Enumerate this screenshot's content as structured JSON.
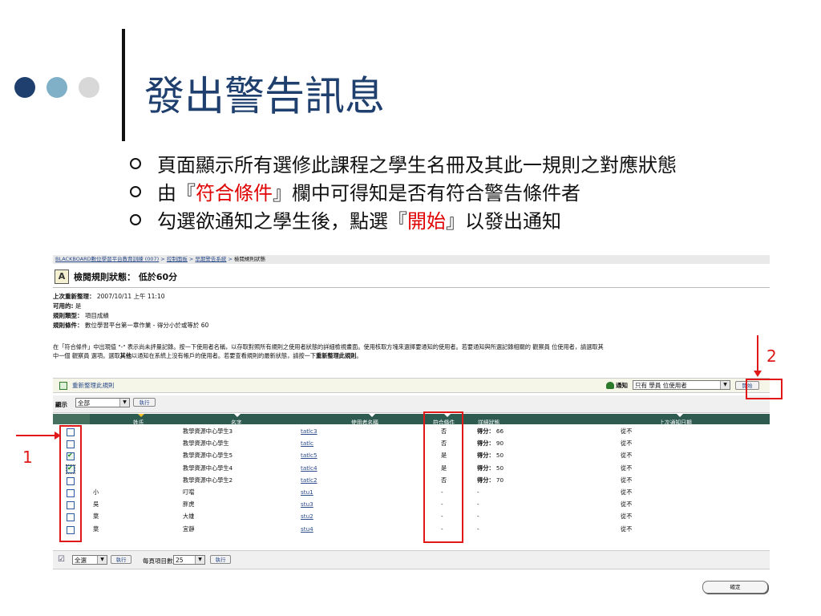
{
  "slide": {
    "title": "發出警告訊息",
    "bullets": [
      {
        "before": "頁面顯示所有選修此課程之學生名冊及其此一規則之對應狀態",
        "highlight": "",
        "after": ""
      },
      {
        "before": "由『",
        "highlight": "符合條件",
        "after": "』欄中可得知是否有符合警告條件者"
      },
      {
        "before": "勾選欲通知之學生後，點選『",
        "highlight": "開始",
        "after": "』以發出通知"
      }
    ],
    "colors": {
      "title": "#1f3f6e",
      "highlight": "#e00000",
      "annotation": "#e01818",
      "header": "#2e5b4f"
    }
  },
  "breadcrumb": {
    "items": [
      "BLACKBOARD數位學習平台教育訓練 (007)",
      "控制面板",
      "早期警告系統"
    ],
    "current": "檢閱規則狀態"
  },
  "page": {
    "title": "檢閱規則狀態： 低於60分"
  },
  "meta": {
    "last_updated_label": "上次重新整理：",
    "last_updated": "2007/10/11 上午 11:10",
    "available_label": "可用的:",
    "available": "是",
    "rule_type_label": "規則類型：",
    "rule_type": "項目成績",
    "rule_condition_label": "規則條件：",
    "rule_condition": "數位學習平台第一章作業 - 得分小於或等於 60"
  },
  "description": {
    "line1": "在「符合條件」中出現值 \"-\" 表示尚未評量記錄。按一下使用者名稱，以存取對照所有規則之使用者狀態的詳細檢視畫面。使用核取方塊來選擇要通知的使用者。若要通知與所選記錄相關的 觀察員 位使用者，請選取其",
    "line2_a": "中一個 觀察員 選項。選取",
    "line2_b": "其他",
    "line2_c": "以通知在系統上沒有帳戶的使用者。若要查看規則的最新狀態，請按一下",
    "line2_d": "重新整理此規則",
    "line2_e": "。"
  },
  "actionbar": {
    "refresh_label": "重新整理此規則",
    "notify_label": "通知",
    "notify_select": "只有 學員 位使用者",
    "start_button": "開始"
  },
  "filterbar": {
    "show_label": "顯示",
    "show_select": "全部",
    "go_button": "執行"
  },
  "table": {
    "headers": [
      "姓氏",
      "名字",
      "使用者名稱",
      "符合條件",
      "詳細狀態",
      "上次通知日期"
    ],
    "rows": [
      {
        "checked": false,
        "last": "",
        "first": "教學資源中心學生3",
        "username": "tatlc3",
        "meets": "否",
        "status_label": "得分：",
        "status_value": "66",
        "last_notified": "從不"
      },
      {
        "checked": false,
        "last": "",
        "first": "教學資源中心學生",
        "username": "tatlc",
        "meets": "否",
        "status_label": "得分：",
        "status_value": "90",
        "last_notified": "從不"
      },
      {
        "checked": true,
        "last": "",
        "first": "教學資源中心學生5",
        "username": "tatlc5",
        "meets": "是",
        "status_label": "得分：",
        "status_value": "50",
        "last_notified": "從不"
      },
      {
        "checked": true,
        "last": "",
        "first": "教學資源中心學生4",
        "username": "tatlc4",
        "meets": "是",
        "status_label": "得分：",
        "status_value": "50",
        "last_notified": "從不"
      },
      {
        "checked": false,
        "last": "",
        "first": "教學資源中心學生2",
        "username": "tatlc2",
        "meets": "否",
        "status_label": "得分：",
        "status_value": "70",
        "last_notified": "從不"
      },
      {
        "checked": false,
        "last": "小",
        "first": "叮噹",
        "username": "stu1",
        "meets": "-",
        "status_label": "",
        "status_value": "-",
        "last_notified": "從不"
      },
      {
        "checked": false,
        "last": "吳",
        "first": "胖虎",
        "username": "stu3",
        "meets": "-",
        "status_label": "",
        "status_value": "-",
        "last_notified": "從不"
      },
      {
        "checked": false,
        "last": "葉",
        "first": "大雄",
        "username": "stu2",
        "meets": "-",
        "status_label": "",
        "status_value": "-",
        "last_notified": "從不"
      },
      {
        "checked": false,
        "last": "葉",
        "first": "宜靜",
        "username": "stu4",
        "meets": "-",
        "status_label": "",
        "status_value": "-",
        "last_notified": "從不"
      }
    ]
  },
  "bottombar": {
    "select_all": "全選",
    "go_button": "執行",
    "per_page_label": "每頁項目數",
    "per_page_value": "25",
    "go_button2": "執行"
  },
  "ok_button": "確定",
  "annotations": {
    "label1": "1",
    "label2": "2"
  }
}
